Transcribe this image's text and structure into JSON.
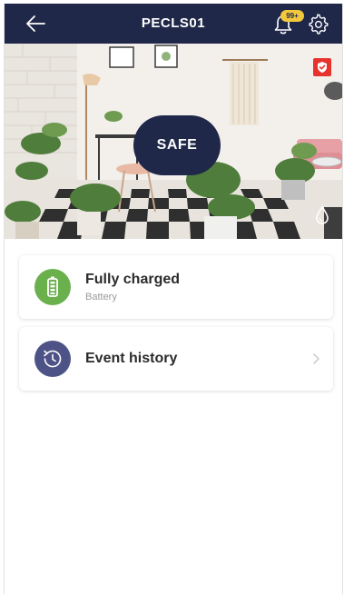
{
  "header": {
    "title": "PECLS01",
    "notification_badge": "99+",
    "icons": {
      "back": "back-arrow-icon",
      "notifications": "bell-icon",
      "settings": "gear-icon"
    }
  },
  "camera": {
    "status_label": "SAFE",
    "icons": {
      "security": "shield-check-icon",
      "water": "water-drop-icon"
    }
  },
  "cards": {
    "battery": {
      "title": "Fully charged",
      "subtitle": "Battery",
      "icon": "battery-icon"
    },
    "history": {
      "title": "Event history",
      "icon": "history-clock-icon"
    }
  },
  "colors": {
    "header_bg": "#20284a",
    "safe_badge_bg": "#20284a",
    "notification_badge": "#f3c93b",
    "battery_green": "#6ab04c",
    "history_navy": "#4d5387",
    "shield_red": "#e7332e"
  }
}
